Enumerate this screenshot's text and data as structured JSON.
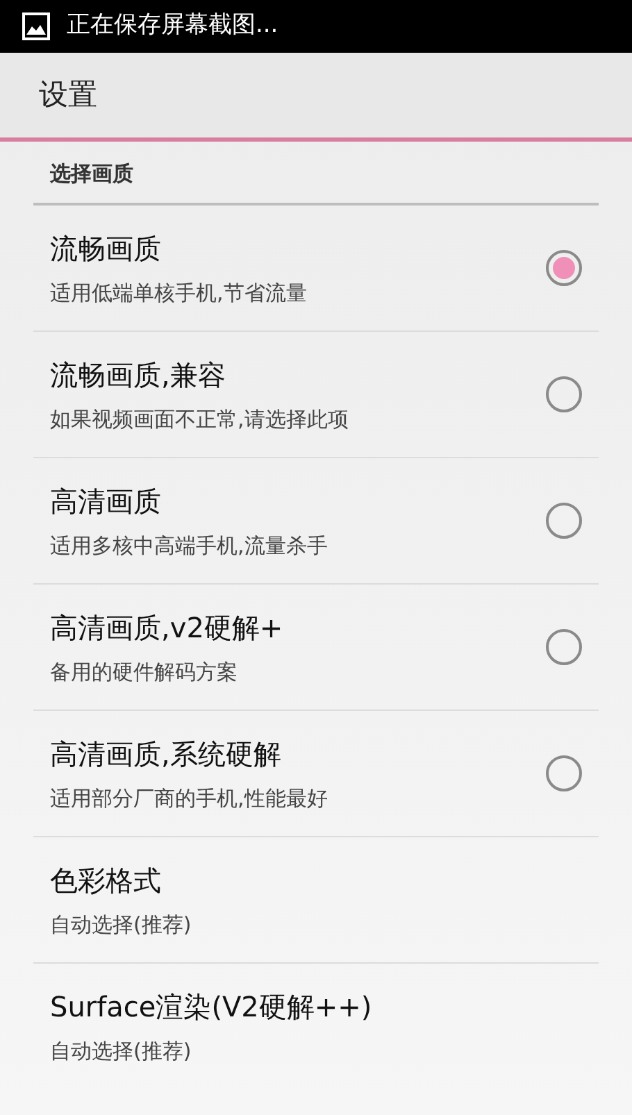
{
  "status_bar": {
    "notification": "正在保存屏幕截图..."
  },
  "header": {
    "title": "设置"
  },
  "section": {
    "title": "选择画质"
  },
  "items": [
    {
      "kind": "radio",
      "title": "流畅画质",
      "summary": "适用低端单核手机,节省流量",
      "selected": true
    },
    {
      "kind": "radio",
      "title": "流畅画质,兼容",
      "summary": "如果视频画面不正常,请选择此项",
      "selected": false
    },
    {
      "kind": "radio",
      "title": "高清画质",
      "summary": "适用多核中高端手机,流量杀手",
      "selected": false
    },
    {
      "kind": "radio",
      "title": "高清画质,v2硬解+",
      "summary": "备用的硬件解码方案",
      "selected": false
    },
    {
      "kind": "radio",
      "title": "高清画质,系统硬解",
      "summary": "适用部分厂商的手机,性能最好",
      "selected": false
    },
    {
      "kind": "plain",
      "title": "色彩格式",
      "summary": "自动选择(推荐)"
    },
    {
      "kind": "plain",
      "title": "Surface渲染(V2硬解++)",
      "summary": "自动选择(推荐)"
    }
  ]
}
